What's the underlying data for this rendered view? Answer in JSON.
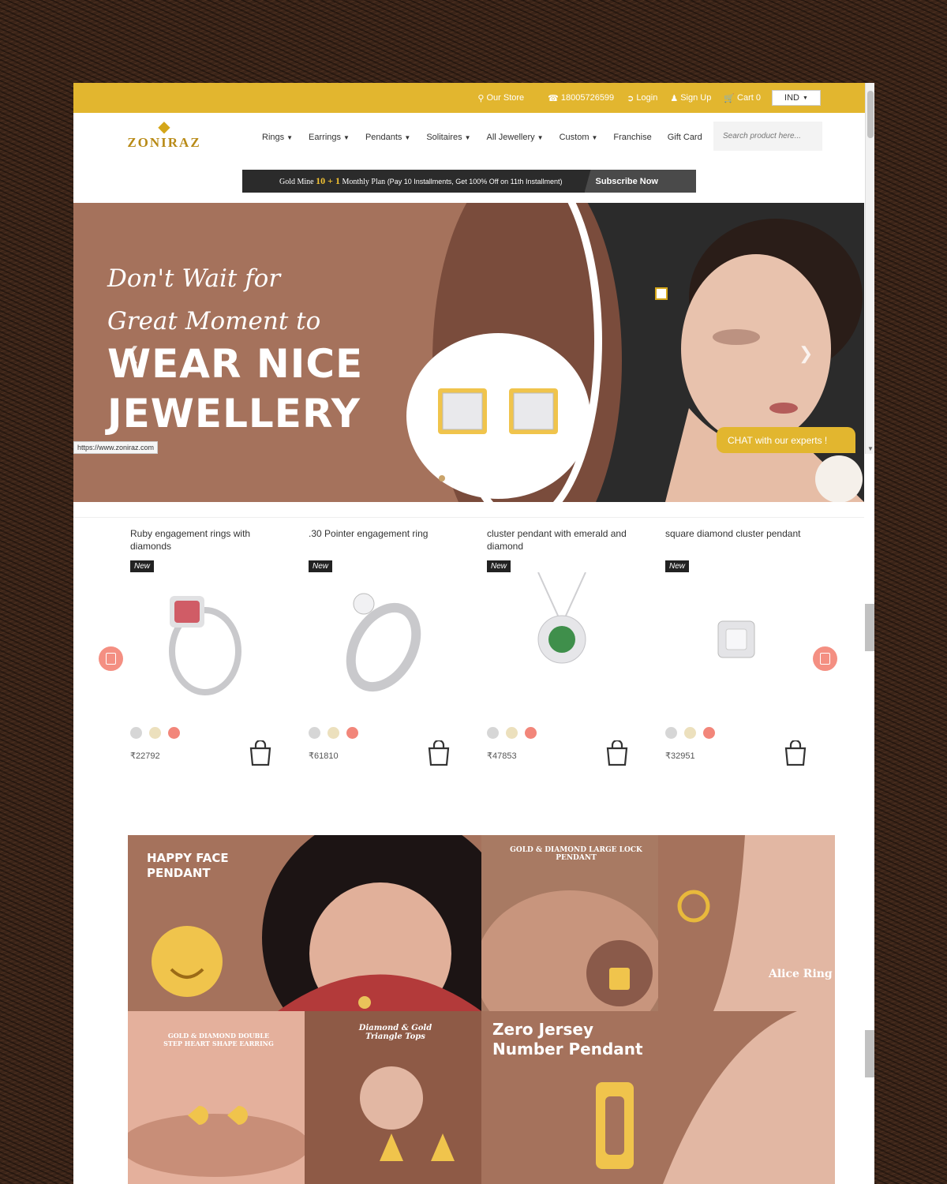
{
  "topbar": {
    "store": "Our Store",
    "phone": "18005726599",
    "login": "Login",
    "signup": "Sign Up",
    "cart": "Cart 0",
    "currency": "IND"
  },
  "header": {
    "logo": "ZONIRAZ",
    "nav": [
      "Rings",
      "Earrings",
      "Pendants",
      "Solitaires",
      "All Jewellery",
      "Custom",
      "Franchise",
      "Gift Card"
    ],
    "search_placeholder": "Search product here..."
  },
  "promo": {
    "prefix": "Gold Mine",
    "highlight": "10 + 1",
    "text": "Monthly Plan",
    "detail": "(Pay 10 Installments, Get 100% Off on 11th Installment)",
    "cta": "Subscribe Now"
  },
  "hero": {
    "line1": "Don't Wait for",
    "line2": "Great Moment to",
    "line3": "WEAR NICE",
    "line4": "JEWELLERY"
  },
  "chat": "CHAT with our experts !",
  "status_url": "https://www.zoniraz.com",
  "products": [
    {
      "name": "Ruby engagement rings with diamonds",
      "badge": "New",
      "price": "₹22792"
    },
    {
      "name": ".30 Pointer engagement ring",
      "badge": "New",
      "price": "₹61810"
    },
    {
      "name": "cluster pendant with emerald and diamond",
      "badge": "New",
      "price": "₹47853"
    },
    {
      "name": "square diamond cluster pendant",
      "badge": "New",
      "price": "₹32951"
    }
  ],
  "swatch_colors": [
    "#d6d6d6",
    "#ece0bd",
    "#f2867a"
  ],
  "banners": {
    "happy_face": "HAPPY FACE PENDANT",
    "lock": "GOLD & DIAMOND LARGE LOCK PENDANT",
    "alice": "Alice Ring",
    "heart": "GOLD & DIAMOND DOUBLE STEP HEART SHAPE EARRING",
    "triangle": "Diamond & Gold Triangle Tops",
    "jersey_1": "Zero Jersey",
    "jersey_2": "Number Pendant"
  },
  "colors": {
    "accent": "#e2b62f",
    "brown": "#a5725c",
    "coral": "#f48f82"
  }
}
